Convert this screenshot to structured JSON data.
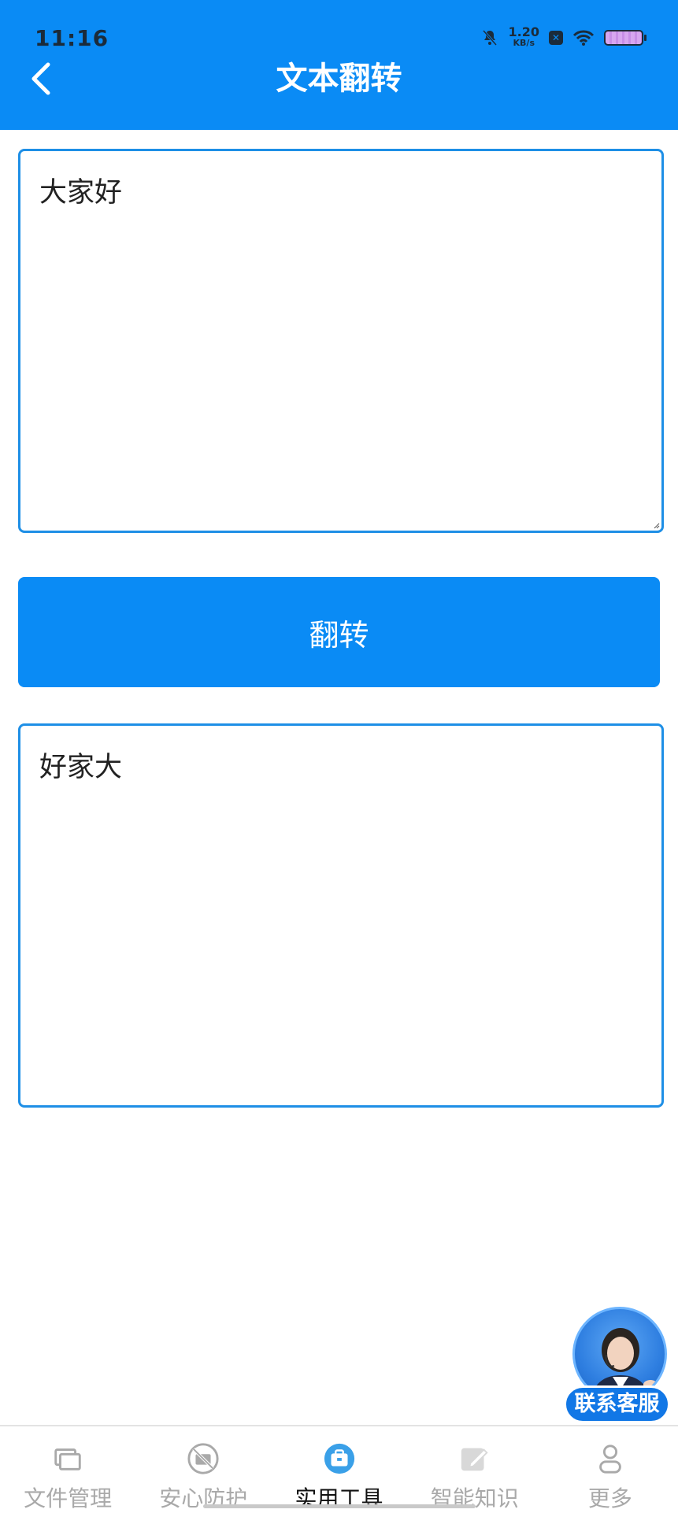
{
  "status_bar": {
    "time": "11:16",
    "net_speed_value": "1.20",
    "net_speed_unit": "KB/s",
    "icons": [
      "mute-bell-icon",
      "speed-indicator",
      "x-app-badge-icon",
      "wifi-icon",
      "battery-icon"
    ]
  },
  "header": {
    "title": "文本翻转",
    "back_icon": "chevron-left-icon",
    "background_color": "#0a8bf5"
  },
  "input": {
    "value": "大家好"
  },
  "action": {
    "flip_label": "翻转",
    "button_color": "#0a8bf5"
  },
  "output": {
    "value": "好家大"
  },
  "customer_service": {
    "label": "联系客服",
    "icon": "customer-service-avatar"
  },
  "tabbar": {
    "items": [
      {
        "label": "文件管理",
        "icon": "folder-icon",
        "active": false
      },
      {
        "label": "安心防护",
        "icon": "shield-camera-icon",
        "active": false
      },
      {
        "label": "实用工具",
        "icon": "toolbox-icon",
        "active": true
      },
      {
        "label": "智能知识",
        "icon": "pencil-note-icon",
        "active": false
      },
      {
        "label": "更多",
        "icon": "user-icon",
        "active": false
      }
    ],
    "active_color": "#3aa0e8",
    "inactive_color": "#a9a9a9"
  }
}
